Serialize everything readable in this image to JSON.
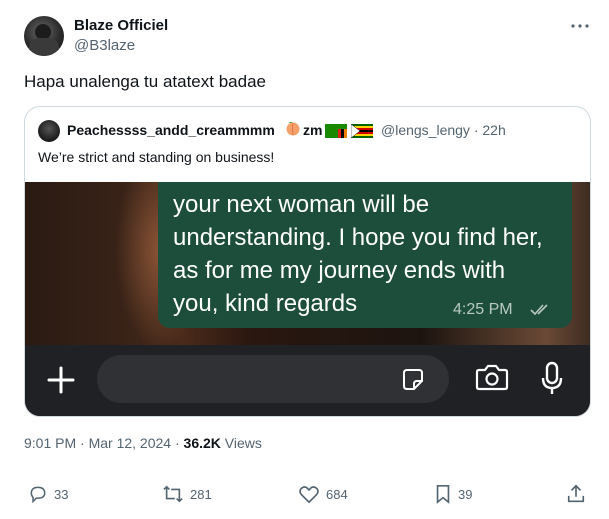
{
  "author": {
    "name": "Blaze Officiel",
    "handle": "@B3laze"
  },
  "tweet": {
    "text": "Hapa unalenga tu atatext badae"
  },
  "quote": {
    "name": "Peachessss_andd_creammmm",
    "flag_text": "zm",
    "handle_time": "@lengs_lengy · 22h",
    "text": "We’re strict and standing on business!",
    "media": {
      "message": "your next woman will be understanding. I hope you find her, as for me my journey ends with you, kind regards",
      "time": "4:25 PM"
    }
  },
  "meta": {
    "time_date": "9:01 PM · Mar 12, 2024 · ",
    "views_count": "36.2K",
    "views_label": " Views"
  },
  "actions": {
    "replies": "33",
    "reposts": "281",
    "likes": "684",
    "bookmarks": "39"
  },
  "icons": [
    "more-icon",
    "reply-icon",
    "repost-icon",
    "like-icon",
    "bookmark-icon",
    "share-icon",
    "plus-icon",
    "sticker-icon",
    "camera-icon",
    "microphone-icon",
    "double-check-icon"
  ]
}
